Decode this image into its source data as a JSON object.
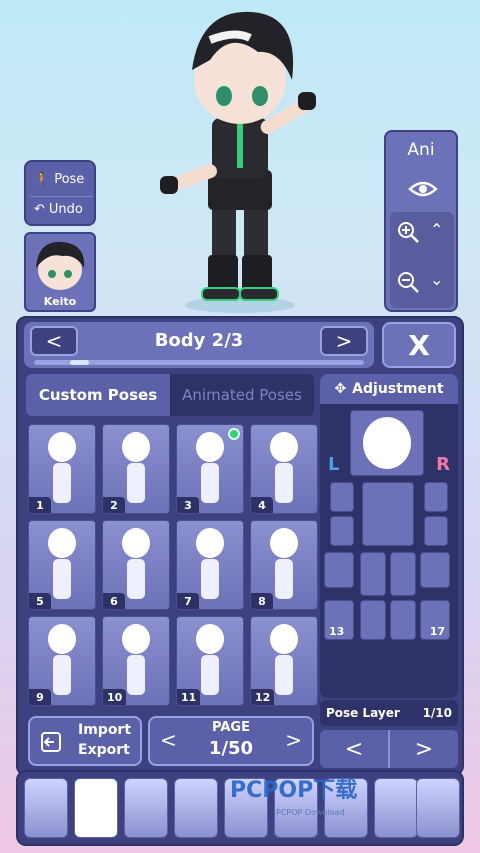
{
  "side": {
    "pose_label": "Pose",
    "undo_label": "Undo",
    "character_name": "Keito"
  },
  "right_panel": {
    "ani_label": "Ani"
  },
  "header": {
    "title": "Body 2/3",
    "close_label": "X",
    "progress": 0.12
  },
  "tabs": {
    "custom": "Custom Poses",
    "animated": "Animated Poses"
  },
  "poses": [
    {
      "num": "1"
    },
    {
      "num": "2"
    },
    {
      "num": "3",
      "selected": true
    },
    {
      "num": "4"
    },
    {
      "num": "5"
    },
    {
      "num": "6"
    },
    {
      "num": "7"
    },
    {
      "num": "8"
    },
    {
      "num": "9"
    },
    {
      "num": "10"
    },
    {
      "num": "11"
    },
    {
      "num": "12"
    }
  ],
  "import": {
    "line1": "Import",
    "line2": "Export"
  },
  "page": {
    "label": "PAGE",
    "value": "1/50"
  },
  "adjustment": {
    "title": "Adjustment",
    "left": "L",
    "right": "R",
    "part_13": "13",
    "part_17": "17",
    "pose_layer_label": "Pose Layer",
    "pose_layer_value": "1/10"
  },
  "watermark": {
    "text": "PCPOP下载",
    "sub": "PCPOP Download"
  },
  "colors": {
    "accent": "#6d71b7",
    "dark": "#3e4180",
    "selected": "#36d07a",
    "left_blue": "#4aa3e0",
    "right_pink": "#f07aa8"
  }
}
